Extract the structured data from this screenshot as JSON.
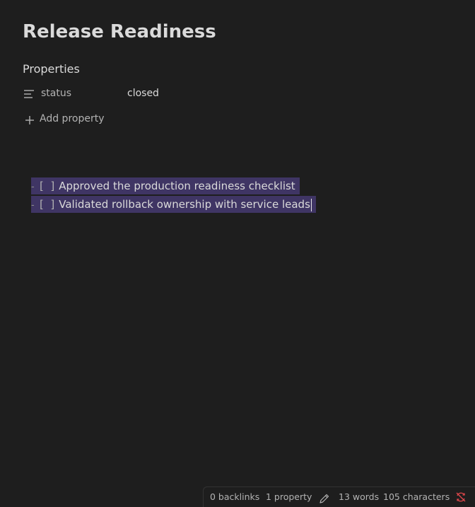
{
  "note": {
    "title": "Release Readiness"
  },
  "properties": {
    "heading": "Properties",
    "items": [
      {
        "icon": "text-lines-icon",
        "key": "status",
        "value": "closed"
      }
    ],
    "add_label": "Add property",
    "add_icon": "plus-icon"
  },
  "content": {
    "tasks": [
      {
        "bullet": "-",
        "checkbox": "[  ]",
        "text": "Approved the production readiness checklist"
      },
      {
        "bullet": "-",
        "checkbox": "[  ]",
        "text": "Validated rollback ownership with service leads"
      }
    ]
  },
  "status_bar": {
    "backlinks": "0 backlinks",
    "properties": "1 property",
    "words": "13 words",
    "characters": "105 characters",
    "edit_icon": "pencil-icon",
    "sync_icon": "sync-error-icon"
  },
  "colors": {
    "background": "#1e1e1e",
    "selection": "#3f3564",
    "text": "#dadada",
    "muted": "#b3b3b3",
    "sync_error": "#e0474c"
  }
}
